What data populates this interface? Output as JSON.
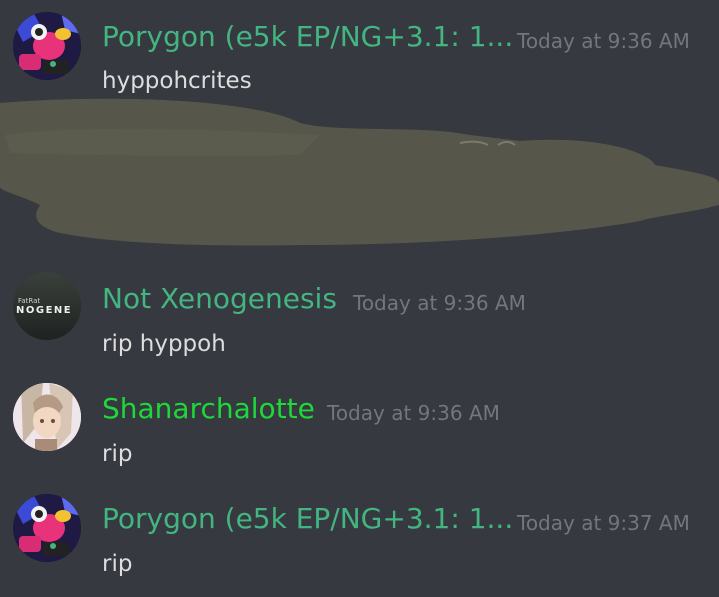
{
  "messages": [
    {
      "author": "Porygon (e5k EP/NG+3.1: 1...",
      "timestamp": "Today at 9:36 AM",
      "text": "hyppohcrites",
      "name_color": "#43b581",
      "avatar_icon": "porygon-avatar-icon"
    },
    {
      "author": "Not Xenogenesis",
      "timestamp": "Today at 9:36 AM",
      "text": "rip hyppoh",
      "name_color": "#43b581",
      "avatar_icon": "fatrat-xenogenesis-avatar-icon",
      "avatar_text_small": "FatRat",
      "avatar_text_big": "NOGENE"
    },
    {
      "author": "Shanarchalotte",
      "timestamp": "Today at 9:36 AM",
      "text": "rip",
      "name_color": "#1ed83a",
      "avatar_icon": "anime-character-avatar-icon"
    },
    {
      "author": "Porygon (e5k EP/NG+3.1: 1...",
      "timestamp": "Today at 9:37 AM",
      "text": "rip",
      "name_color": "#43b581",
      "avatar_icon": "porygon-avatar-icon"
    }
  ],
  "colors": {
    "background": "#36393f",
    "timestamp": "#72767d",
    "message_text": "#dcddde",
    "scribble": "#56574a"
  }
}
